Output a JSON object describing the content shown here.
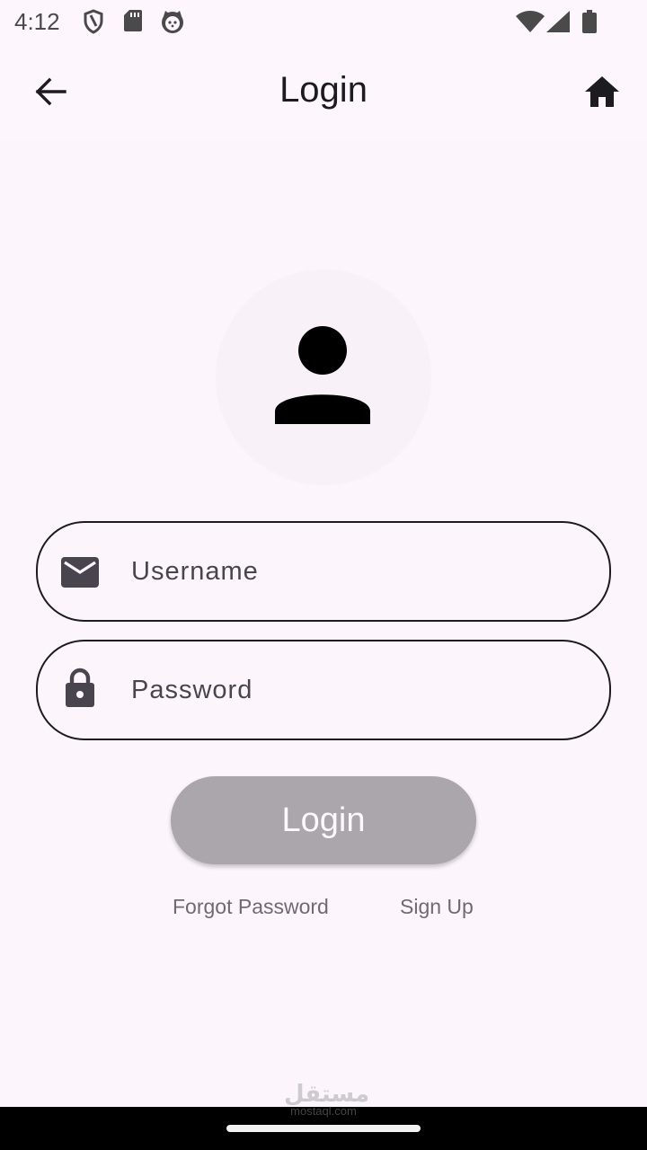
{
  "status_bar": {
    "time": "4:12",
    "left_icons": [
      "shield-icon",
      "sd-card-icon",
      "cat-face-icon"
    ],
    "right_icons": [
      "wifi-icon",
      "cell-signal-icon",
      "battery-icon"
    ]
  },
  "app_bar": {
    "title": "Login",
    "back_icon": "arrow-back-icon",
    "home_icon": "home-icon"
  },
  "avatar": {
    "icon": "person-icon"
  },
  "form": {
    "username": {
      "placeholder": "Username",
      "value": "",
      "icon": "mail-icon"
    },
    "password": {
      "placeholder": "Password",
      "value": "",
      "icon": "lock-icon"
    },
    "login_label": "Login",
    "forgot_password_label": "Forgot Password",
    "sign_up_label": "Sign Up"
  },
  "watermark": {
    "main": "مستقل",
    "sub": "mostaql.com"
  },
  "colors": {
    "background": "#fcf6fc",
    "text": "#1c1b1f",
    "button_disabled": "#aba6ab",
    "link": "#6f6a72"
  }
}
